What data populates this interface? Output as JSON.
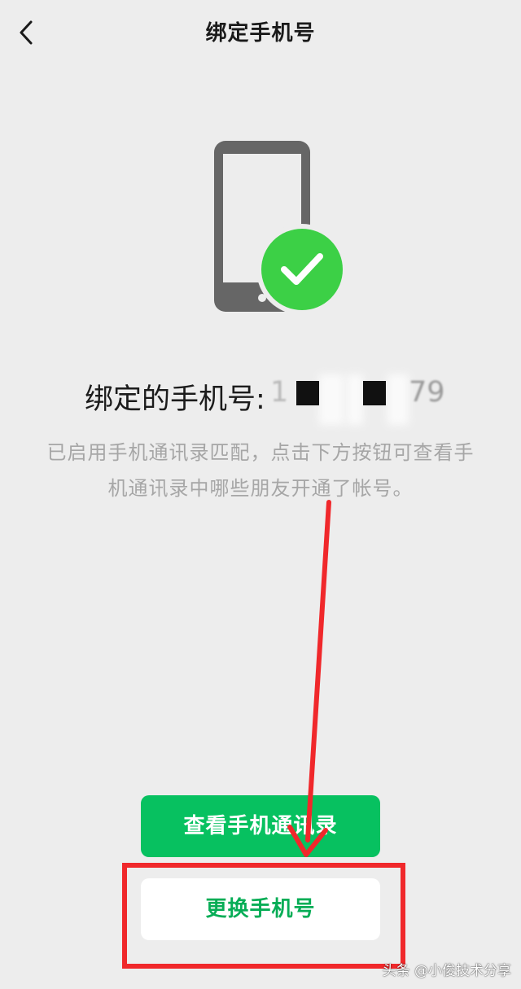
{
  "header": {
    "title": "绑定手机号",
    "back_icon": "chevron-left-icon"
  },
  "illustration": {
    "icon": "phone-check-icon",
    "phone_color": "#666666",
    "check_color": "#3cd046"
  },
  "bound": {
    "label": "绑定的手机号:",
    "number_first": "1",
    "number_last": "79"
  },
  "description": {
    "line1": "已启用手机通讯录匹配，点击下方按钮可查看手",
    "line2": "机通讯录中哪些朋友开通了帐号。"
  },
  "buttons": {
    "view_contacts": "查看手机通讯录",
    "change_number": "更换手机号"
  },
  "colors": {
    "primary_green": "#07c160",
    "secondary_text_green": "#06ad56",
    "annotation_red": "#f0282b",
    "background": "#ededed"
  },
  "watermark": {
    "text": "头条 @小俊技术分享"
  }
}
